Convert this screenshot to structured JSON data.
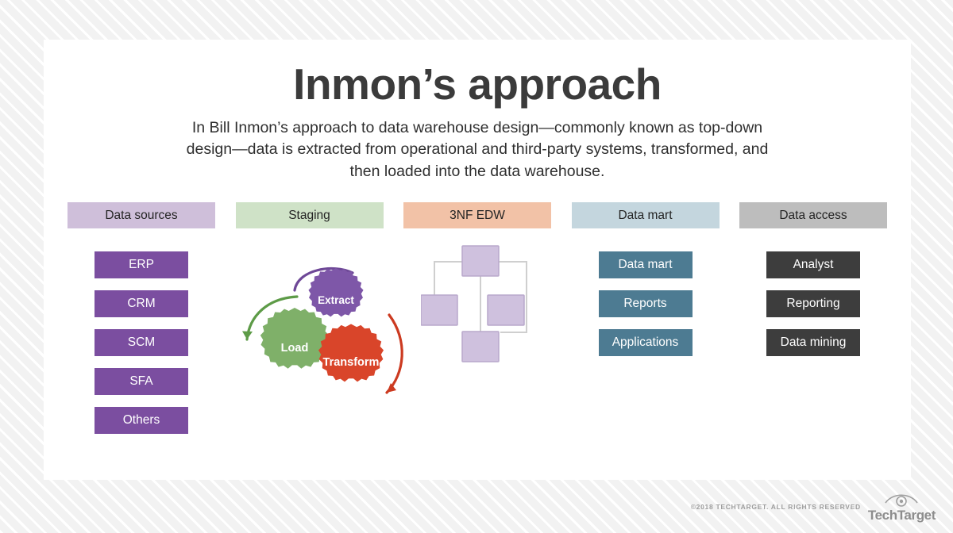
{
  "header": {
    "title": "Inmon’s approach",
    "subtitle": "In Bill Inmon’s approach to data warehouse design—commonly known as top-down design—data is extracted from operational and third-party systems, transformed, and then loaded into the data warehouse."
  },
  "columns": [
    {
      "key": "data-sources",
      "header": "Data sources",
      "header_color": "#cfbfda",
      "item_color": "#7b4ea0",
      "items": [
        "ERP",
        "CRM",
        "SCM",
        "SFA",
        "Others"
      ]
    },
    {
      "key": "staging",
      "header": "Staging",
      "header_color": "#cfe2c7",
      "gears": [
        {
          "label": "Extract",
          "color": "#7e57a8",
          "arrow_color": "#6e4897"
        },
        {
          "label": "Load",
          "color": "#7fb069",
          "arrow_color": "#5d9b47"
        },
        {
          "label": "Transform",
          "color": "#d9452a",
          "arrow_color": "#cc3a20"
        }
      ]
    },
    {
      "key": "3nf-edw",
      "header": "3NF EDW",
      "header_color": "#f2c2a7",
      "node_color": "#cfc1de",
      "node_border": "#b9a8cc",
      "link_color": "#cfcfcf",
      "node_count": 4
    },
    {
      "key": "data-mart",
      "header": "Data mart",
      "header_color": "#c4d6de",
      "item_color": "#4d7b92",
      "items": [
        "Data mart",
        "Reports",
        "Applications"
      ]
    },
    {
      "key": "data-access",
      "header": "Data access",
      "header_color": "#bdbdbd",
      "item_color": "#3d3d3d",
      "items": [
        "Analyst",
        "Reporting",
        "Data mining"
      ]
    }
  ],
  "footer": {
    "copyright": "©2018 TECHTARGET. ALL RIGHTS RESERVED",
    "brand": "TechTarget",
    "logo_icon": "eye-icon"
  }
}
